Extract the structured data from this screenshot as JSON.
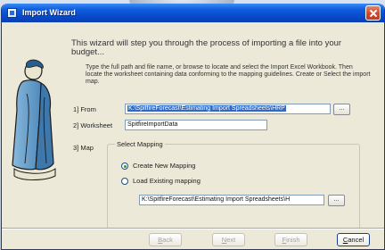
{
  "window": {
    "title": "Import Wizard"
  },
  "intro": "This wizard will step you through the process of importing a file into your budget...",
  "instructions": "Type the full path and file name, or browse to locate and select the Import Excel Workbook. Then locate the worksheet containing data conforming to the mapping guidelines. Create or Select the import map.",
  "from": {
    "label": "1] From",
    "value": "K:\\SpitfireForecast\\Estimating Import Spreadsheets\\HRP",
    "browse_label": "..."
  },
  "worksheet": {
    "label": "2] Worksheet",
    "value": "SpitfireImportData"
  },
  "map": {
    "label": "3] Map",
    "group_title": "Select Mapping",
    "options": [
      {
        "label": "Create New Mapping",
        "checked": true
      },
      {
        "label": "Load Existing mapping",
        "checked": false
      }
    ],
    "path_value": "K:\\SpitfireForecast\\Estimating Import Spreadsheets\\H",
    "browse_label": "..."
  },
  "buttons": {
    "back": {
      "prefix": "",
      "accel": "B",
      "rest": "ack",
      "enabled": false
    },
    "next": {
      "prefix": "",
      "accel": "N",
      "rest": "ext",
      "enabled": false
    },
    "finish": {
      "prefix": "",
      "accel": "F",
      "rest": "inish",
      "enabled": false
    },
    "cancel": {
      "prefix": "",
      "accel": "C",
      "rest": "ancel",
      "enabled": true
    }
  },
  "icons": {
    "app": "wizard-app-icon",
    "close": "close-icon",
    "illustration": "figure-illustration"
  },
  "colors": {
    "titlebar": "#0848c9",
    "selection": "#316ac5",
    "radio_dot": "#21a121"
  }
}
